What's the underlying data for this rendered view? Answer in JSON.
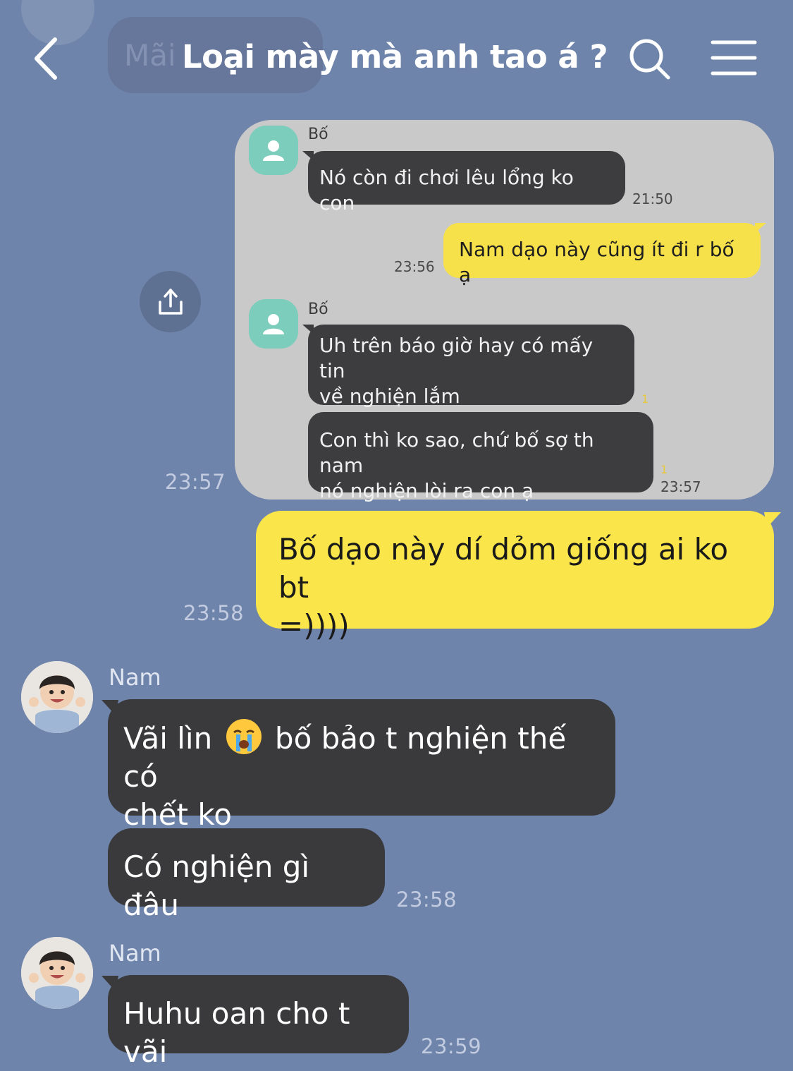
{
  "header": {
    "title": "Loại mày mà anh tao á ?",
    "ghost_text": "Mãi ..."
  },
  "quote": {
    "sender_1": "Bố",
    "msg_1": "Nó còn đi chơi lêu lổng ko con",
    "time_1": "21:50",
    "reply": "Nam dạo này cũng ít đi r bố ạ",
    "reply_time": "23:56",
    "sender_2": "Bố",
    "msg_2a_line1": "Uh trên báo giờ hay có mấy tin",
    "msg_2a_line2": "về nghiện lắm",
    "msg_2a_unread": "1",
    "msg_2b_line1": "Con thì ko sao, chứ bố sợ th nam",
    "msg_2b_line2": "nó nghiện lòi ra con ạ",
    "msg_2b_unread": "1",
    "time_2": "23:57"
  },
  "chat": {
    "quote_time": "23:57",
    "my_msg_line1": "Bố dạo này dí dỏm giống ai ko bt",
    "my_msg_line2": "=))))",
    "my_msg_time": "23:58",
    "name_1": "Nam",
    "msg_1_line1_a": "Vãi lìn",
    "msg_1_line1_b": "bố bảo t nghiện thế có",
    "msg_1_line2": "chết ko",
    "msg_2": "Có nghiện gì đâu",
    "time_1": "23:58",
    "name_2": "Nam",
    "msg_3": "Huhu oan cho t vãi",
    "time_2": "23:59"
  },
  "icons": {
    "back": "chevron-left-icon",
    "search": "search-icon",
    "menu": "hamburger-menu-icon",
    "share": "share-icon",
    "emoji": "crying-face-emoji"
  },
  "colors": {
    "background": "#6f84aa",
    "my_bubble": "#fae64a",
    "other_bubble": "#3a3a3c",
    "quote_card": "#c9c9ca"
  }
}
